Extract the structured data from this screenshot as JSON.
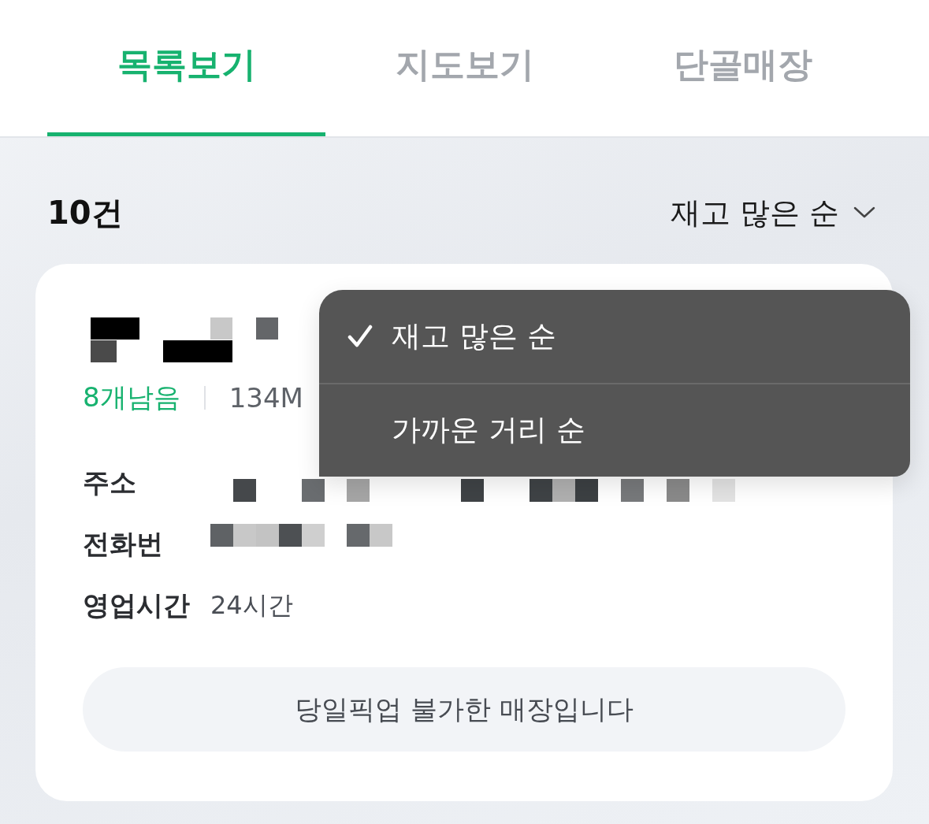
{
  "tabs": [
    {
      "label": "목록보기",
      "selected": true
    },
    {
      "label": "지도보기",
      "selected": false
    },
    {
      "label": "단골매장",
      "selected": false
    }
  ],
  "list_header": {
    "count": "10건",
    "sort": {
      "label": "재고 많은 순",
      "expanded": true
    }
  },
  "sort_menu": {
    "options": [
      {
        "label": "재고 많은 순",
        "selected": true
      },
      {
        "label": "가까운 거리 순",
        "selected": false
      }
    ]
  },
  "store_card": {
    "stock": "8개남음",
    "distance": "134M",
    "details": [
      {
        "label": "주소",
        "kind": "pixelated"
      },
      {
        "label": "전화번",
        "kind": "pixelated"
      },
      {
        "label": "영업시간",
        "kind": "text",
        "value": "24시간"
      }
    ],
    "pickup_notice": "당일픽업 불가한 매장입니다"
  }
}
